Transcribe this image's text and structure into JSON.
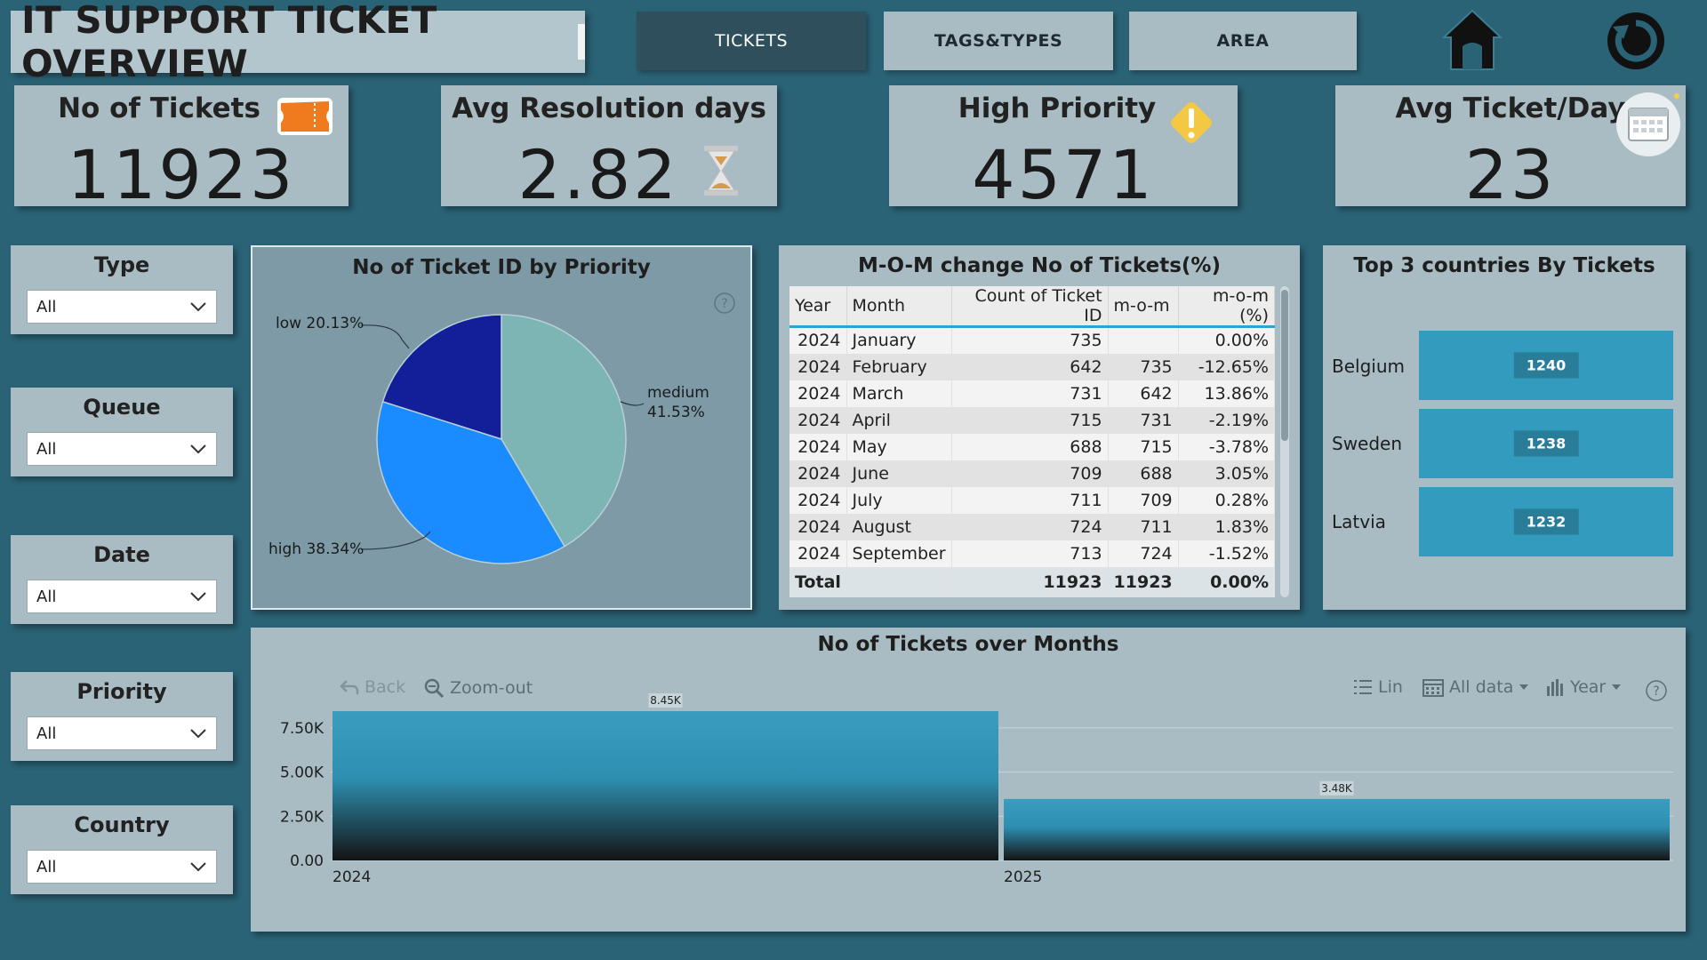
{
  "header": {
    "title": "IT SUPPORT TICKET OVERVIEW",
    "tabs": [
      {
        "label": "TICKETS",
        "active": true
      },
      {
        "label": "TAGS&TYPES",
        "active": false
      },
      {
        "label": "AREA",
        "active": false
      }
    ]
  },
  "kpis": [
    {
      "label": "No of Tickets",
      "value": "11923",
      "icon": "ticket-icon"
    },
    {
      "label": "Avg Resolution days",
      "value": "2.82",
      "icon": "hourglass-icon"
    },
    {
      "label": "High Priority",
      "value": "4571",
      "icon": "warning-icon"
    },
    {
      "label": "Avg Ticket/Day",
      "value": "23",
      "icon": "calendar-icon"
    }
  ],
  "slicers": [
    {
      "title": "Type",
      "value": "All"
    },
    {
      "title": "Queue",
      "value": "All"
    },
    {
      "title": "Date",
      "value": "All"
    },
    {
      "title": "Priority",
      "value": "All"
    },
    {
      "title": "Country",
      "value": "All"
    }
  ],
  "pie": {
    "title": "No of Ticket ID by Priority",
    "labels": {
      "low": "low 20.13%",
      "medium": "medium",
      "medium_pct": "41.53%",
      "high": "high 38.34%"
    },
    "colors": {
      "medium": "#7db5b4",
      "high": "#1a8cff",
      "low": "#121f99"
    }
  },
  "mom_table": {
    "title": "M-O-M change No of Tickets(%)",
    "columns": [
      "Year",
      "Month",
      "Count of Ticket ID",
      "m-o-m",
      "m-o-m (%)"
    ],
    "rows": [
      [
        "2024",
        "January",
        "735",
        "",
        "0.00%"
      ],
      [
        "2024",
        "February",
        "642",
        "735",
        "-12.65%"
      ],
      [
        "2024",
        "March",
        "731",
        "642",
        "13.86%"
      ],
      [
        "2024",
        "April",
        "715",
        "731",
        "-2.19%"
      ],
      [
        "2024",
        "May",
        "688",
        "715",
        "-3.78%"
      ],
      [
        "2024",
        "June",
        "709",
        "688",
        "3.05%"
      ],
      [
        "2024",
        "July",
        "711",
        "709",
        "0.28%"
      ],
      [
        "2024",
        "August",
        "724",
        "711",
        "1.83%"
      ],
      [
        "2024",
        "September",
        "713",
        "724",
        "-1.52%"
      ]
    ],
    "total": {
      "label": "Total",
      "count": "11923",
      "mom": "11923",
      "pct": "0.00%"
    }
  },
  "top3": {
    "title": "Top 3 countries By Tickets",
    "items": [
      {
        "country": "Belgium",
        "value": "1240"
      },
      {
        "country": "Sweden",
        "value": "1238"
      },
      {
        "country": "Latvia",
        "value": "1232"
      }
    ]
  },
  "bar_chart": {
    "title": "No of Tickets over Months",
    "toolbar": {
      "back": "Back",
      "zoom_out": "Zoom-out",
      "lin": "Lin",
      "all_data": "All data",
      "year": "Year"
    }
  },
  "chart_data": [
    {
      "type": "pie",
      "title": "No of Ticket ID by Priority",
      "categories": [
        "medium",
        "high",
        "low"
      ],
      "values": [
        41.53,
        38.34,
        20.13
      ]
    },
    {
      "type": "bar",
      "title": "No of Tickets over Months",
      "categories": [
        "2024",
        "2025"
      ],
      "values": [
        8450,
        3480
      ],
      "data_labels": [
        "8.45K",
        "3.48K"
      ],
      "ytick_labels": [
        "0.00",
        "2.50K",
        "5.00K",
        "7.50K"
      ],
      "ylim": [
        0,
        8450
      ],
      "grid": true
    }
  ]
}
